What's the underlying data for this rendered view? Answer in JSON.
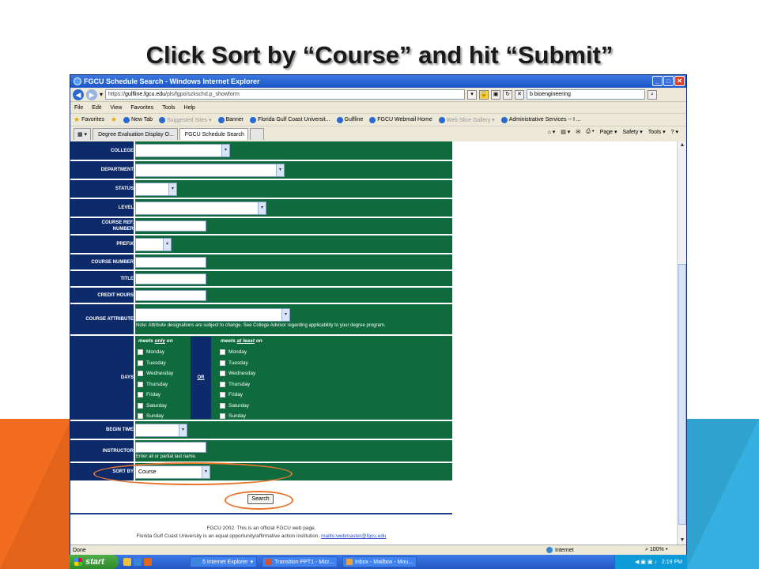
{
  "slide": {
    "title": "Click Sort by “Course” and hit “Submit”"
  },
  "window": {
    "title": "FGCU Schedule Search - Windows Internet Explorer"
  },
  "address": {
    "scheme": "https://",
    "host": "gulfline.fgcu.edu",
    "path": "/pls/fgpo/szkschd.p_showform",
    "search_value": "bioengineering"
  },
  "menu": [
    "File",
    "Edit",
    "View",
    "Favorites",
    "Tools",
    "Help"
  ],
  "favorites": {
    "label": "Favorites",
    "items": [
      {
        "label": "New Tab",
        "gray": false
      },
      {
        "label": "Suggested Sites ▾",
        "gray": true
      },
      {
        "label": "Banner",
        "gray": false
      },
      {
        "label": "Florida Gulf Coast Universit...",
        "gray": false
      },
      {
        "label": "Gulfline",
        "gray": false
      },
      {
        "label": "FGCU Webmail Home",
        "gray": false
      },
      {
        "label": "Web Slice Gallery ▾",
        "gray": true
      },
      {
        "label": "Administrative Services -- I ...",
        "gray": false
      }
    ]
  },
  "tabs": [
    "Degree Evaluation Display O...",
    "FGCU Schedule Search"
  ],
  "tools": [
    "Page ▾",
    "Safety ▾",
    "Tools ▾"
  ],
  "form": {
    "college": "COLLEGE",
    "department": "DEPARTMENT",
    "status": "STATUS",
    "level": "LEVEL",
    "course_ref_1": "COURSE REF.",
    "course_ref_2": "NUMBER",
    "prefix": "PREFIX",
    "course_number": "COURSE NUMBER",
    "title": "TITLE",
    "credit_hours": "CREDIT HOURS",
    "course_attribute": "COURSE ATTRIBUTE",
    "attribute_note": "Note: Attribute designations are subject to change. See College Advisor regarding applicability to your degree program.",
    "days": "DAYS",
    "meets_only_pre": "meets ",
    "meets_only_em": "only",
    "meets_only_post": " on",
    "or_label": "OR",
    "meets_least_pre": "meets ",
    "meets_least_em": "at least",
    "meets_least_post": " on",
    "day_names": [
      "Monday",
      "Tuesday",
      "Wednesday",
      "Thursday",
      "Friday",
      "Saturday",
      "Sunday"
    ],
    "begin_time": "BEGIN TIME",
    "instructor": "INSTRUCTOR",
    "instructor_note": "Enter all or partial last name.",
    "sort_by": "SORT BY",
    "sort_by_value": "Course",
    "search_button": "Search"
  },
  "footer": {
    "line1": "FGCU 2002. This is an official FGCU web page.",
    "line2": "Florida Gulf Coast University is an equal opportunity/affirmative action institution.",
    "mailto": "mailto:webmaster@fgcu.edu"
  },
  "status": {
    "left": "Done",
    "zone": "Internet",
    "zoom": "100%"
  },
  "taskbar": {
    "start": "start",
    "tasks": [
      "5 Internet Explorer",
      "Transition PPT1 - Micr...",
      "Inbox - Mailbox - Mou..."
    ],
    "clock": "2:19 PM"
  }
}
